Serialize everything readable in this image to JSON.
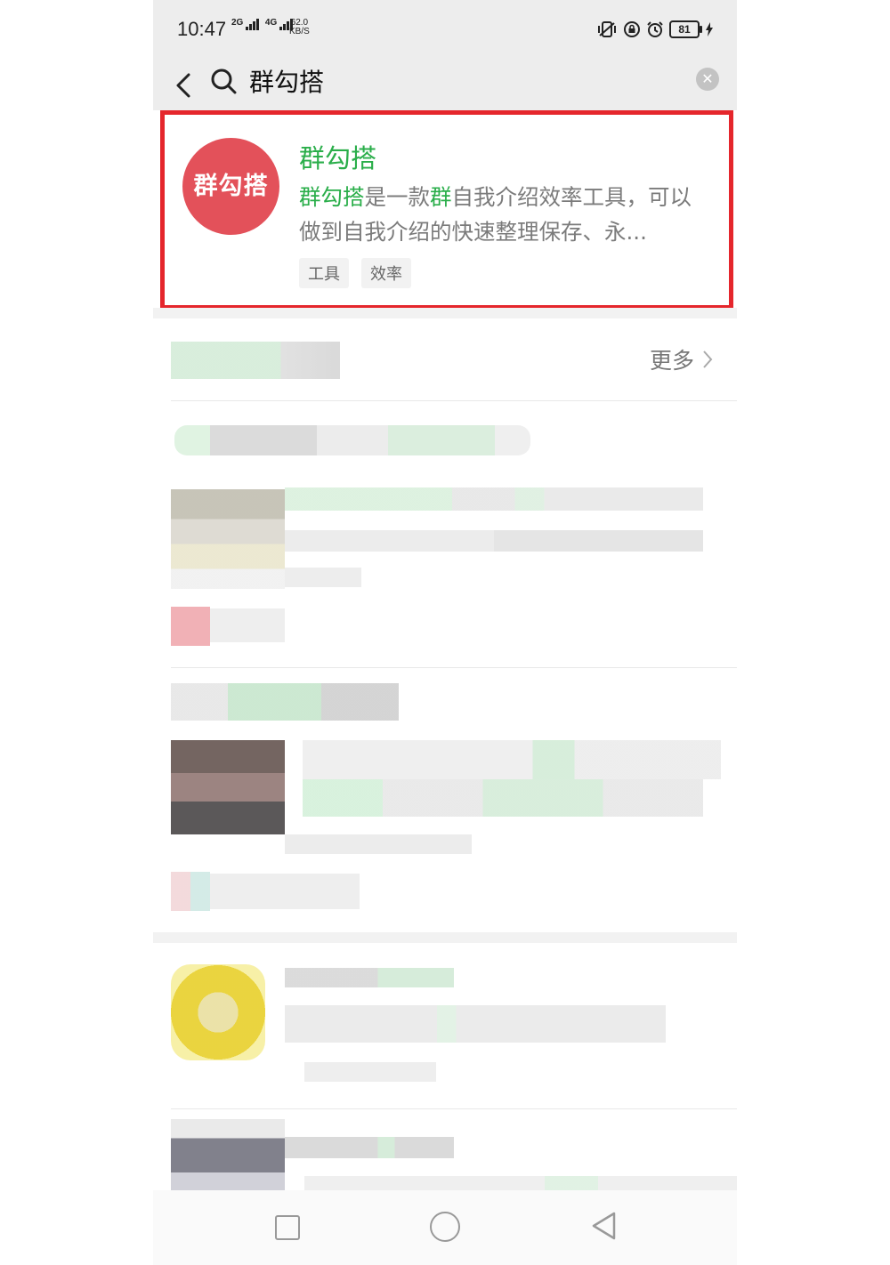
{
  "status_bar": {
    "time": "10:47",
    "network_1": "2G",
    "network_2": "4G",
    "speed_value": "62.0",
    "speed_unit": "KB/S",
    "battery": "81"
  },
  "search": {
    "query": "群勾搭"
  },
  "result": {
    "logo_text": "群勾搭",
    "title": "群勾搭",
    "desc_hl_1": "群勾搭",
    "desc_text_1": "是一款",
    "desc_hl_2": "群",
    "desc_text_2": "自我介绍效率工具，可以做到自我介绍的快速整理保存、永...",
    "tags": [
      "工具",
      "效率"
    ]
  },
  "section": {
    "more_label": "更多"
  },
  "colors": {
    "highlight": "#2aae4a",
    "box_border": "#e5262c",
    "logo_bg": "#e3515a"
  }
}
